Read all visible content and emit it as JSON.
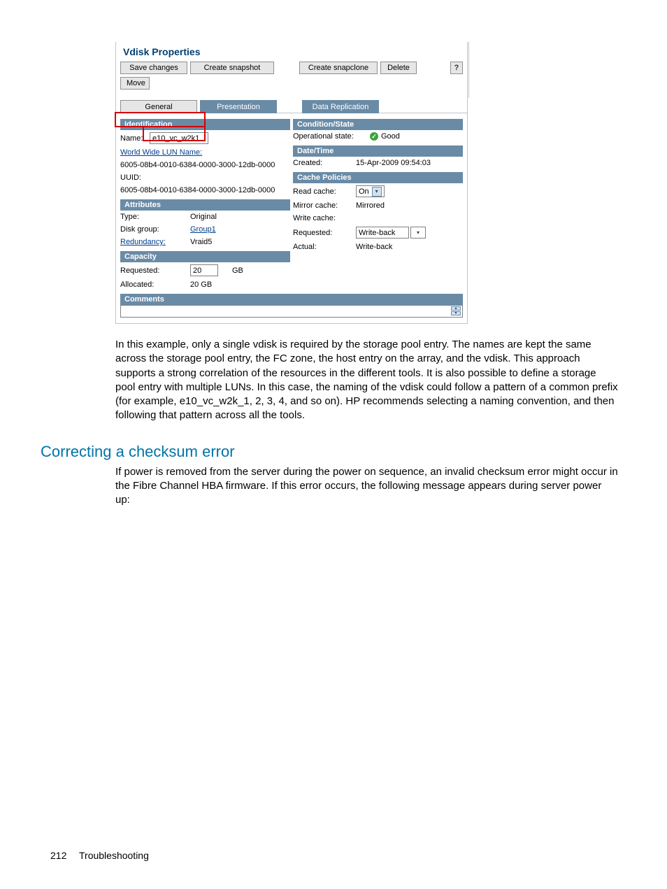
{
  "screenshot": {
    "title": "Vdisk Properties",
    "buttons": {
      "save": "Save changes",
      "snapshot": "Create snapshot",
      "snapclone": "Create snapclone",
      "delete": "Delete",
      "help": "?",
      "move": "Move"
    },
    "tabs": {
      "general": "General",
      "presentation": "Presentation",
      "replication": "Data Replication"
    },
    "identification": {
      "header": "Identification",
      "name_label": "Name:",
      "name_value": "e10_vc_w2k1",
      "wwlun_label": "World Wide LUN Name:",
      "wwlun_value": "6005-08b4-0010-6384-0000-3000-12db-0000",
      "uuid_label": "UUID:",
      "uuid_value": "6005-08b4-0010-6384-0000-3000-12db-0000"
    },
    "attributes": {
      "header": "Attributes",
      "type_label": "Type:",
      "type_value": "Original",
      "dg_label": "Disk group:",
      "dg_value": "Group1",
      "red_label": "Redundancy:",
      "red_value": "Vraid5"
    },
    "capacity": {
      "header": "Capacity",
      "req_label": "Requested:",
      "req_value": "20",
      "req_unit": "GB",
      "alloc_label": "Allocated:",
      "alloc_value": "20 GB"
    },
    "condition": {
      "header": "Condition/State",
      "op_label": "Operational state:",
      "op_value": "Good"
    },
    "datetime": {
      "header": "Date/Time",
      "created_label": "Created:",
      "created_value": "15-Apr-2009 09:54:03"
    },
    "cache": {
      "header": "Cache Policies",
      "read_label": "Read cache:",
      "read_value": "On",
      "mirror_label": "Mirror cache:",
      "mirror_value": "Mirrored",
      "write_label": "Write cache:",
      "req_label": "Requested:",
      "req_value": "Write-back",
      "actual_label": "Actual:",
      "actual_value": "Write-back"
    },
    "comments_header": "Comments"
  },
  "para1": "In this example, only a single vdisk is required by the storage pool entry. The names are kept the same across the storage pool entry, the FC zone, the host entry on the array, and the vdisk. This approach supports a strong correlation of the resources in the different tools. It is also possible to define a storage pool entry with multiple LUNs. In this case, the naming of the vdisk could follow a pattern of a common prefix (for example, e10_vc_w2k_1, 2, 3, 4, and so on). HP recommends selecting a naming convention, and then following that pattern across all the tools.",
  "heading2": "Correcting a checksum error",
  "para2": "If power is removed from the server during the power on sequence, an invalid checksum error might occur in the Fibre Channel HBA firmware. If this error occurs, the following message appears during server power up:",
  "footer": {
    "page": "212",
    "title": "Troubleshooting"
  }
}
